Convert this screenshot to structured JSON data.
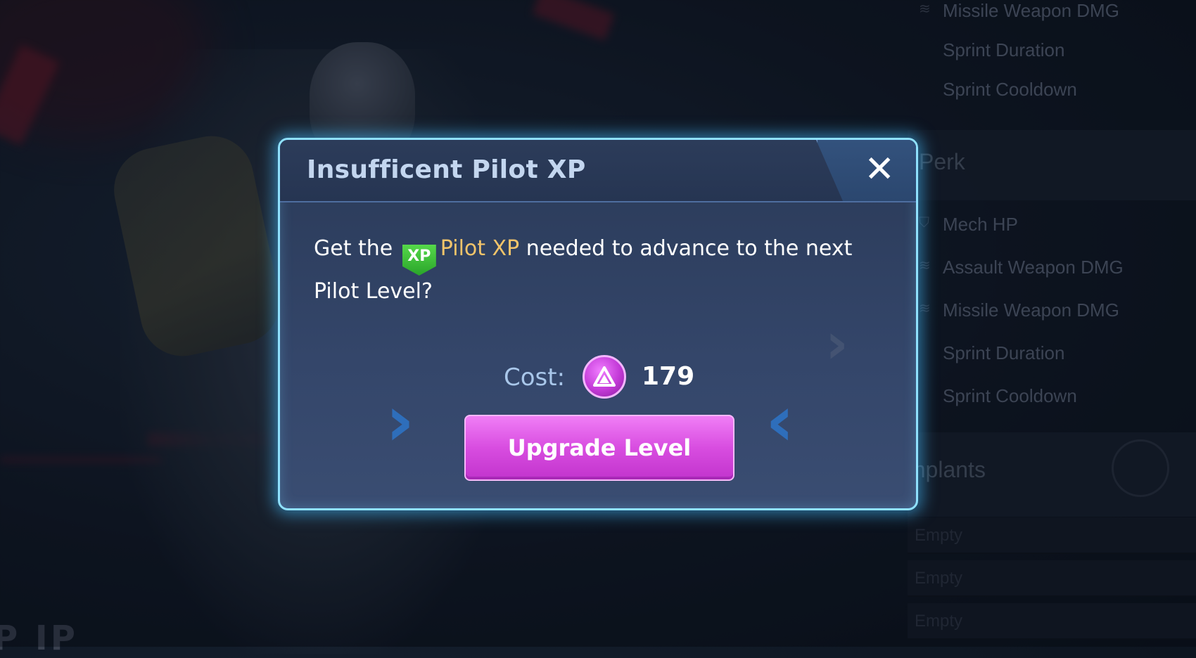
{
  "background": {
    "corner_text": "P  IP",
    "side_panel": {
      "top_items": [
        {
          "label": "Missile Weapon DMG",
          "icon": "wings-icon"
        },
        {
          "label": "Sprint Duration",
          "icon": ""
        },
        {
          "label": "Sprint Cooldown",
          "icon": ""
        }
      ],
      "perk_header": "Perk",
      "perk_items": [
        {
          "label": "Mech HP",
          "icon": "shield-icon"
        },
        {
          "label": "Assault Weapon DMG",
          "icon": "wings-icon"
        },
        {
          "label": "Missile Weapon DMG",
          "icon": "wings-icon"
        },
        {
          "label": "Sprint Duration",
          "icon": ""
        },
        {
          "label": "Sprint Cooldown",
          "icon": ""
        }
      ],
      "implants_header": "Implants",
      "implant_slots": [
        "Empty",
        "Empty",
        "Empty"
      ]
    }
  },
  "dialog": {
    "title": "Insufficent Pilot XP",
    "close_glyph": "✕",
    "message_prefix": "Get the",
    "xp_badge": "XP",
    "message_highlight": "Pilot XP",
    "message_suffix": "needed to advance to the next Pilot Level?",
    "cost_label": "Cost:",
    "cost_currency_icon": "premium-currency-icon",
    "cost_value": "179",
    "button_label": "Upgrade Level"
  },
  "colors": {
    "dialog_border": "#8fe1ff",
    "highlight_text": "#f2c46a",
    "button_magenta": "#d84de0",
    "xp_green": "#2aa52a"
  }
}
